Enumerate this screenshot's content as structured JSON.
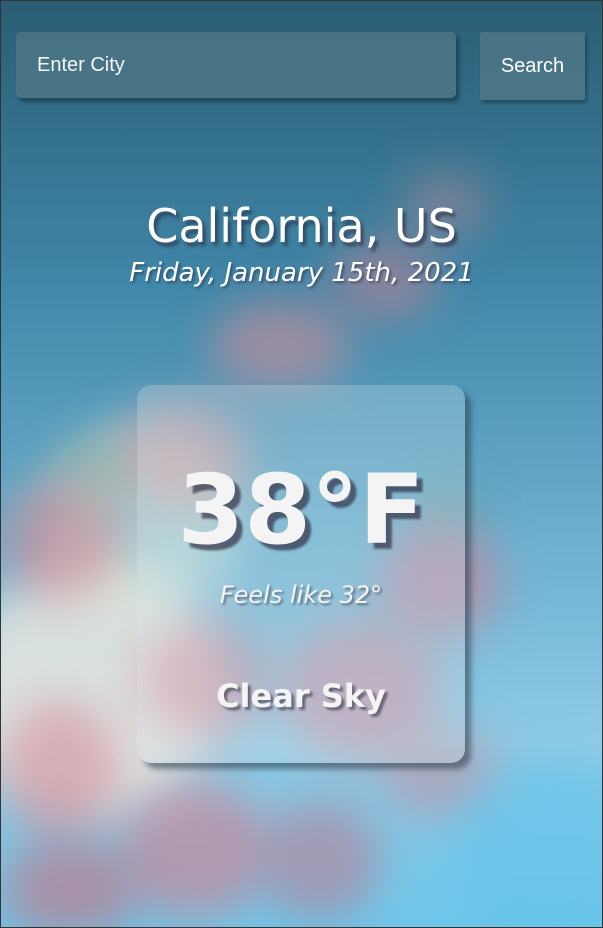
{
  "search": {
    "placeholder": "Enter City",
    "value": "",
    "button_label": "Search"
  },
  "location": {
    "city": "California, US",
    "date": "Friday, January 15th, 2021"
  },
  "weather": {
    "temperature": "38°F",
    "feels_like": "Feels like 32°",
    "condition": "Clear Sky"
  },
  "colors": {
    "search_bg": "#50788a",
    "text": "#ffffff",
    "sky_top": "#2a5d73",
    "sky_bottom": "#6ec6ea",
    "blossom": "#d98a9a"
  }
}
